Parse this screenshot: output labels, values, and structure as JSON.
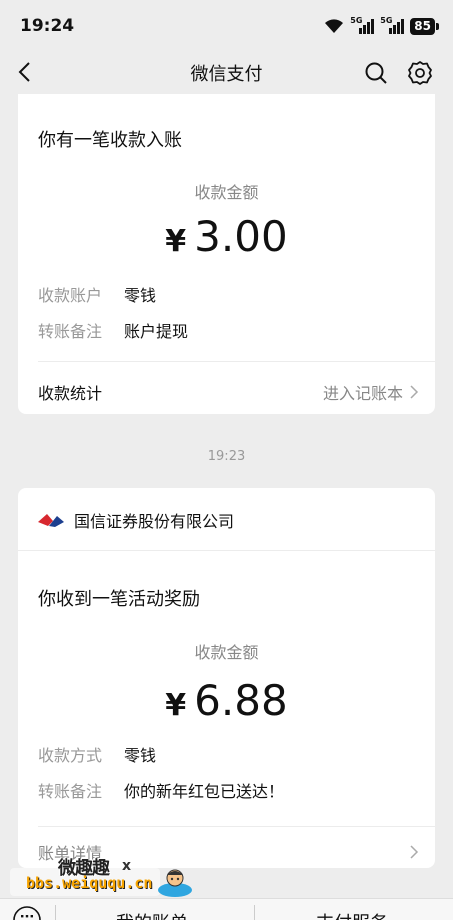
{
  "status_bar": {
    "time": "19:24",
    "battery": "85",
    "network_1": "5G",
    "network_2": "5G"
  },
  "nav": {
    "title": "微信支付",
    "icons": [
      "back-arrow-icon",
      "search-icon",
      "gear-icon"
    ]
  },
  "card1": {
    "heading": "你有一笔收款入账",
    "amount_label": "收款金额",
    "currency": "¥",
    "amount": "3.00",
    "rows": [
      {
        "key": "收款账户",
        "value": "零钱"
      },
      {
        "key": "转账备注",
        "value": "账户提现"
      }
    ],
    "link_label": "收款统计",
    "link_action": "进入记账本"
  },
  "timestamp": "19:23",
  "card2": {
    "sender": "国信证券股份有限公司",
    "heading": "你收到一笔活动奖励",
    "amount_label": "收款金额",
    "currency": "¥",
    "amount": "6.88",
    "rows": [
      {
        "key": "收款方式",
        "value": "零钱"
      },
      {
        "key": "转账备注",
        "value": "你的新年红包已送达！"
      }
    ],
    "link_label": "账单详情"
  },
  "watermark": {
    "title": "微趣趣",
    "url": "bbs.weiququ.cn",
    "mark": "x"
  },
  "tab_bar": {
    "items": [
      "我的账单",
      "支付服务"
    ]
  },
  "colors": {
    "background": "#ededed",
    "card": "#ffffff",
    "muted_text": "#999999",
    "watermark_url": "#f7a400",
    "logo_red": "#d7282f",
    "logo_blue": "#1c3f8f"
  }
}
